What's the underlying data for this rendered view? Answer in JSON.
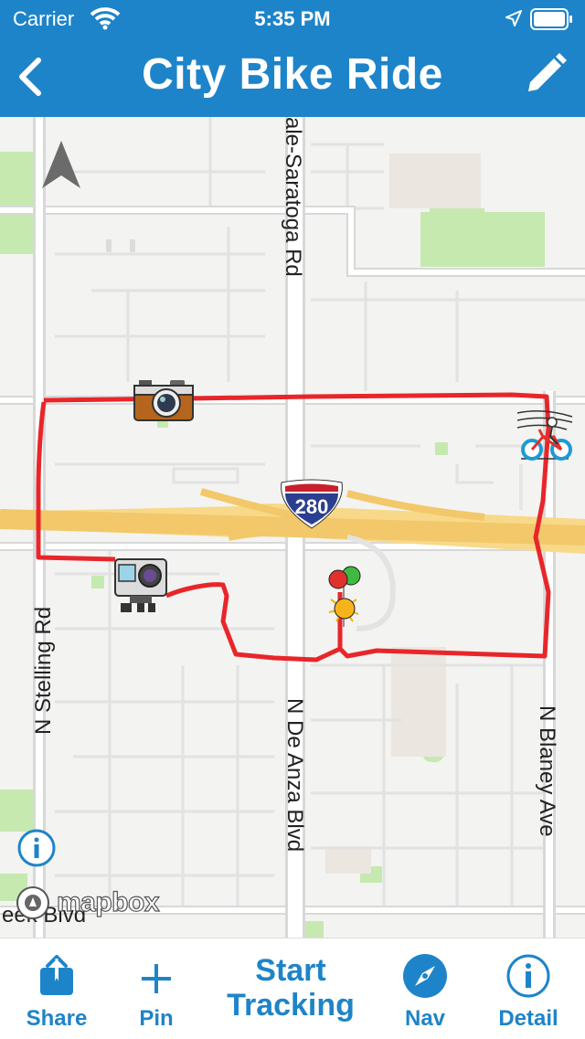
{
  "status_bar": {
    "carrier": "Carrier",
    "time": "5:35 PM"
  },
  "nav": {
    "title": "City Bike Ride"
  },
  "map": {
    "road_labels": {
      "top_road": "ale-Saratoga Rd",
      "stelling": "N Stelling Rd",
      "de_anza": "N De Anza Blvd",
      "blaney": "N Blaney Ave",
      "creek": "eek Blvd"
    },
    "highway_shield": "280",
    "attribution": "mapbox",
    "route_color": "#e8262a",
    "markers": [
      "camera-marker",
      "action-camera-marker",
      "balloons-marker",
      "bicycle-marker"
    ]
  },
  "tabbar": {
    "share": "Share",
    "pin": "Pin",
    "start_line1": "Start",
    "start_line2": "Tracking",
    "nav": "Nav",
    "detail": "Detail"
  },
  "colors": {
    "accent": "#1e84c9"
  }
}
